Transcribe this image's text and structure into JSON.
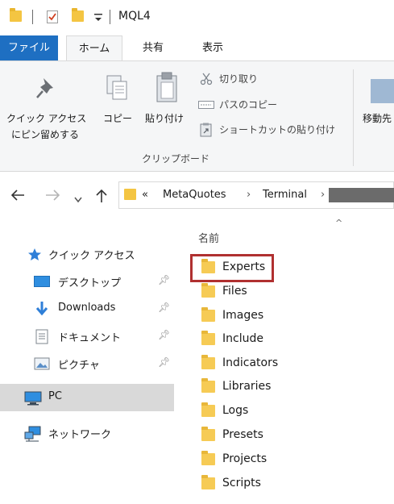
{
  "window": {
    "title": "MQL4"
  },
  "ribbon": {
    "tabs": [
      {
        "label": "ファイル"
      },
      {
        "label": "ホーム"
      },
      {
        "label": "共有"
      },
      {
        "label": "表示"
      }
    ],
    "pin_button": {
      "line1": "クイック アクセス",
      "line2": "にピン留めする"
    },
    "copy_label": "コピー",
    "paste_label": "貼り付け",
    "cut_label": "切り取り",
    "copy_path_label": "パスのコピー",
    "paste_shortcut_label": "ショートカットの貼り付け",
    "move_to_label": "移動先",
    "group_label": "クリップボード"
  },
  "address": {
    "prefix": "«",
    "segments": [
      "MetaQuotes",
      "Terminal"
    ]
  },
  "sidebar": {
    "items": [
      {
        "label": "クイック アクセス",
        "icon": "star-icon"
      },
      {
        "label": "デスクトップ",
        "icon": "desktop-icon"
      },
      {
        "label": "Downloads",
        "icon": "download-icon"
      },
      {
        "label": "ドキュメント",
        "icon": "document-icon"
      },
      {
        "label": "ピクチャ",
        "icon": "picture-icon"
      },
      {
        "label": "PC",
        "icon": "pc-icon"
      },
      {
        "label": "ネットワーク",
        "icon": "network-icon"
      }
    ]
  },
  "files": {
    "column_header": "名前",
    "items": [
      "Experts",
      "Files",
      "Images",
      "Include",
      "Indicators",
      "Libraries",
      "Logs",
      "Presets",
      "Projects",
      "Scripts"
    ],
    "highlighted": "Experts"
  },
  "colors": {
    "accent": "#1e6fc2",
    "folder": "#f6cb55",
    "highlight": "#b03030",
    "selected": "#d9d9d9"
  }
}
